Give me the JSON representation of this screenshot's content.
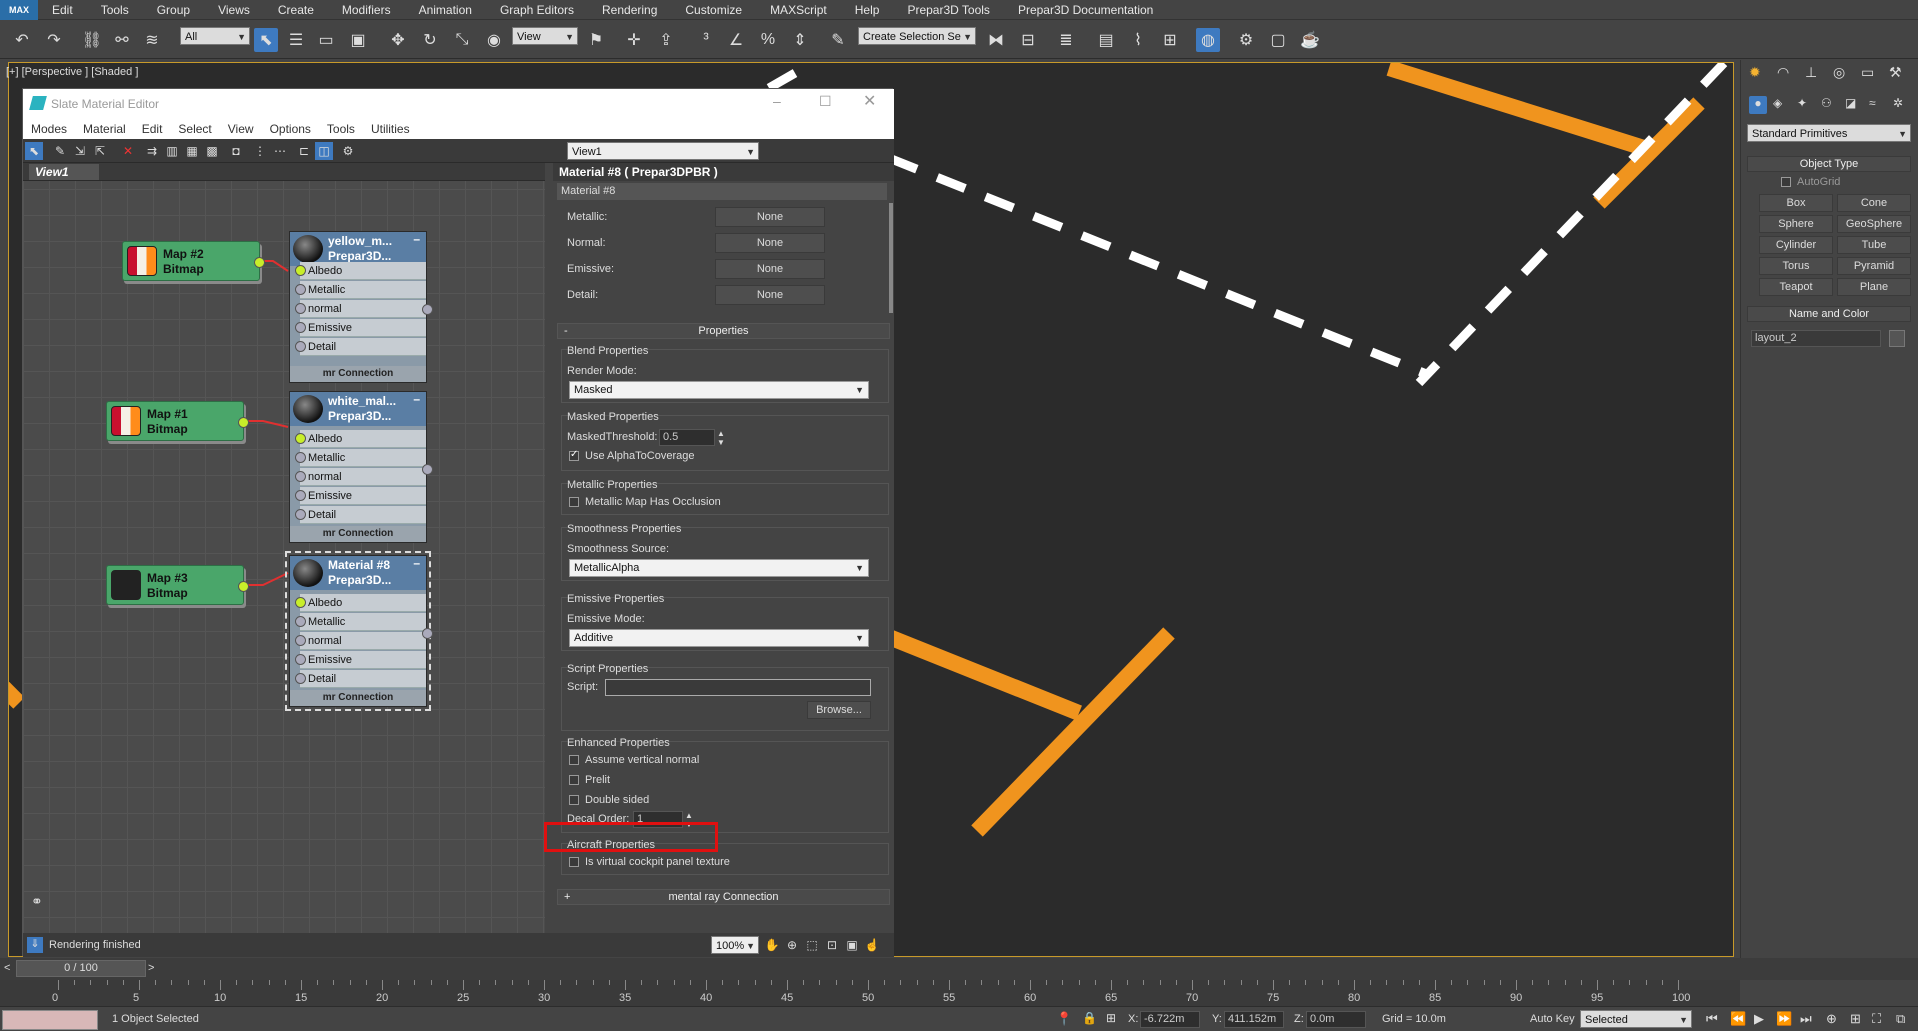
{
  "app": {
    "logo": "MAX",
    "menu": [
      "Edit",
      "Tools",
      "Group",
      "Views",
      "Create",
      "Modifiers",
      "Animation",
      "Graph Editors",
      "Rendering",
      "Customize",
      "MAXScript",
      "Help",
      "Prepar3D Tools",
      "Prepar3D Documentation"
    ]
  },
  "toolbar": {
    "selection_filter": "All",
    "ref_coord": "View",
    "named_selection": "Create Selection Se"
  },
  "viewport": {
    "label": "[+] [Perspective ] [Shaded ]"
  },
  "command_panel": {
    "category": "Standard Primitives",
    "object_type_title": "Object Type",
    "autogrid": "AutoGrid",
    "buttons": [
      "Box",
      "Cone",
      "Sphere",
      "GeoSphere",
      "Cylinder",
      "Tube",
      "Torus",
      "Pyramid",
      "Teapot",
      "Plane"
    ],
    "name_color_title": "Name and Color",
    "object_name": "layout_2"
  },
  "sme": {
    "title": "Slate Material Editor",
    "menu": [
      "Modes",
      "Material",
      "Edit",
      "Select",
      "View",
      "Options",
      "Tools",
      "Utilities"
    ],
    "view_dropdown": "View1",
    "view_tab": "View1",
    "status": "Rendering finished",
    "zoom": "100%",
    "nodes": {
      "bitmaps": [
        {
          "name": "Map #2",
          "type": "Bitmap",
          "swatch": [
            "#c8102e",
            "#f5f0e6",
            "#ff8c1a"
          ]
        },
        {
          "name": "Map #1",
          "type": "Bitmap",
          "swatch": [
            "#c8102e",
            "#f5f0e6",
            "#ff8c1a"
          ]
        },
        {
          "name": "Map #3",
          "type": "Bitmap",
          "swatch": [
            "#222222",
            "#222222",
            "#222222"
          ]
        }
      ],
      "materials": [
        {
          "name": "yellow_m...",
          "type": "Prepar3D..."
        },
        {
          "name": "white_mal...",
          "type": "Prepar3D..."
        },
        {
          "name": "Material #8",
          "type": "Prepar3D..."
        }
      ],
      "slots": [
        "Albedo",
        "Metallic",
        "normal",
        "Emissive",
        "Detail"
      ],
      "footer": "mr Connection"
    }
  },
  "params": {
    "header": "Material #8 ( Prepar3DPBR )",
    "name_field": "Material #8",
    "maps": [
      {
        "label": "Metallic:",
        "value": "None"
      },
      {
        "label": "Normal:",
        "value": "None"
      },
      {
        "label": "Emissive:",
        "value": "None"
      },
      {
        "label": "Detail:",
        "value": "None"
      }
    ],
    "properties_title": "Properties",
    "blend": {
      "title": "Blend Properties",
      "label": "Render Mode:",
      "value": "Masked"
    },
    "masked": {
      "title": "Masked Properties",
      "threshold_label": "MaskedThreshold:",
      "threshold": "0.5",
      "alpha_label": "Use AlphaToCoverage"
    },
    "metallic": {
      "title": "Metallic Properties",
      "occlusion_label": "Metallic Map Has Occlusion"
    },
    "smoothness": {
      "title": "Smoothness Properties",
      "label": "Smoothness Source:",
      "value": "MetallicAlpha"
    },
    "emissive": {
      "title": "Emissive Properties",
      "label": "Emissive Mode:",
      "value": "Additive"
    },
    "script": {
      "title": "Script Properties",
      "label": "Script:",
      "value": "",
      "browse": "Browse..."
    },
    "enhanced": {
      "title": "Enhanced Properties",
      "vertical_normal": "Assume vertical normal",
      "prelit": "Prelit",
      "double_sided": "Double sided",
      "decal_label": "Decal Order:",
      "decal_value": "1"
    },
    "aircraft": {
      "title": "Aircraft Properties",
      "cockpit": "Is virtual cockpit panel texture"
    },
    "mr_connection": "mental ray Connection"
  },
  "timeline": {
    "frame": "0 / 100",
    "ticks": [
      "0",
      "5",
      "10",
      "15",
      "20",
      "25",
      "30",
      "35",
      "40",
      "45",
      "50",
      "55",
      "60",
      "65",
      "70",
      "75",
      "80",
      "85",
      "90",
      "95",
      "100"
    ]
  },
  "status": {
    "selected": "1 Object Selected",
    "x_label": "X:",
    "x": "-6.722m",
    "y_label": "Y:",
    "y": "411.152m",
    "z_label": "Z:",
    "z": "0.0m",
    "grid": "Grid = 10.0m",
    "autokey": "Auto Key",
    "key_mode": "Selected"
  },
  "colors": {
    "accent": "#3e7ac0",
    "marking_orange": "#f0941e",
    "marking_white": "#ffffff",
    "highlight_red": "#e01010"
  }
}
